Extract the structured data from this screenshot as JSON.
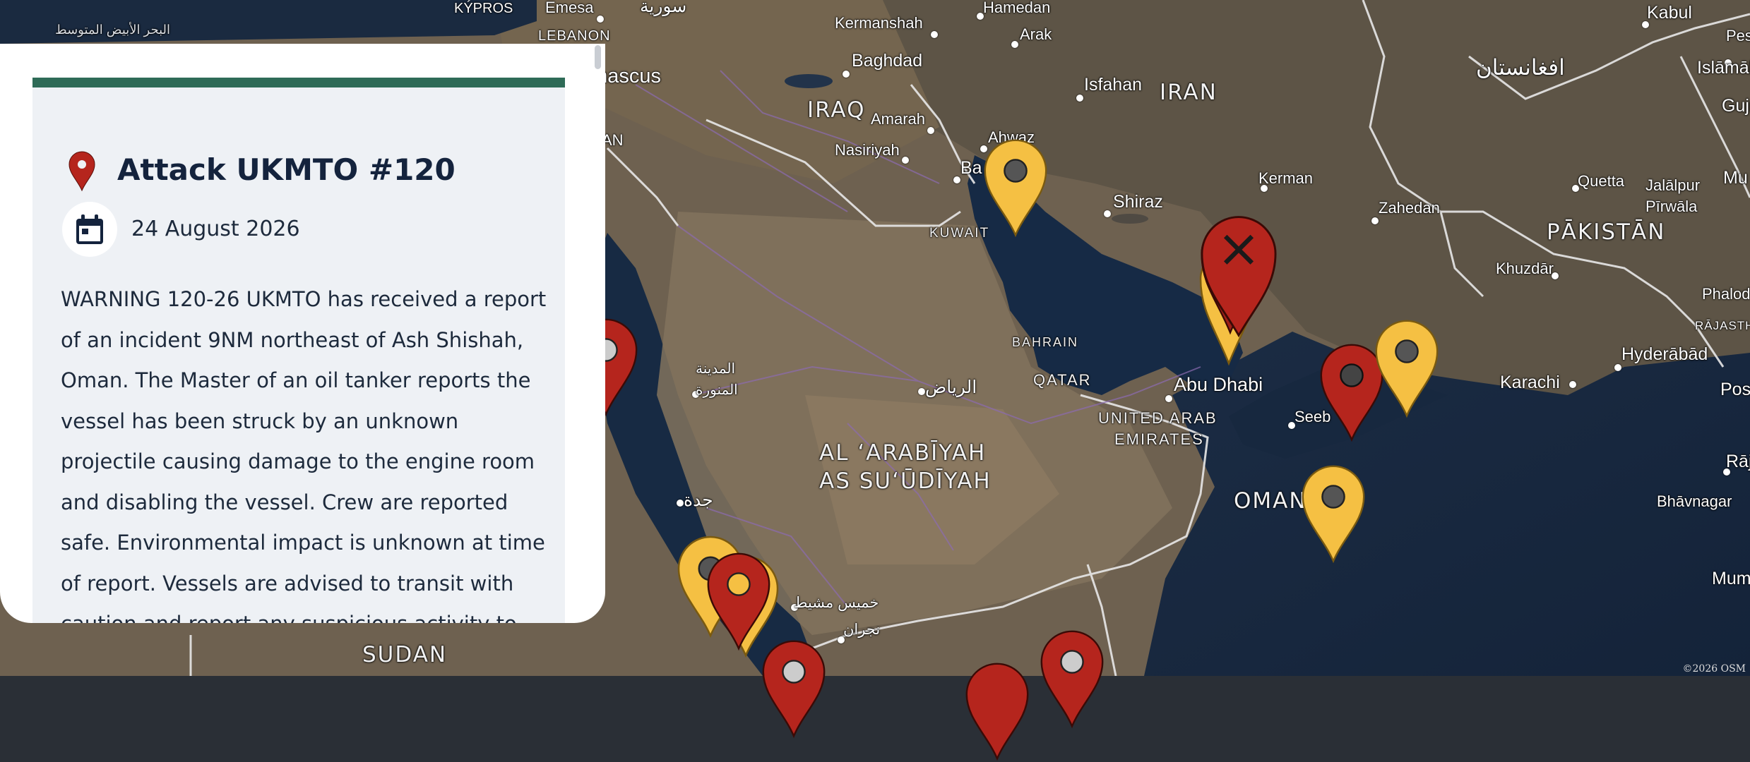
{
  "popup": {
    "title": "Attack UKMTO #120",
    "date": "24 August 2026",
    "body": "WARNING 120-26 UKMTO has received a report of an incident 9NM northeast of Ash Shishah, Oman. The Master of an oil tanker reports the vessel has been struck by an unknown projectile causing damage to the engine room and disabling the vessel. Crew are reported safe. Environmental impact is unknown at time of report. Vessels are advised to transit with caution and report any suspicious activity to UKMTO. Authorities are investigating.",
    "accent_color": "#2e6b57",
    "pin_color": "#b5251d"
  },
  "map": {
    "labels": {
      "iran": "IRAN",
      "iraq": "IRAQ",
      "kuwait": "KUWAIT",
      "bahrain": "BAHRAIN",
      "qatar": "QATAR",
      "uae_1": "UNITED ARAB",
      "uae_2": "EMIRATES",
      "saudi_1": "AL ʻARABĪYAH",
      "saudi_2": "AS SUʻŪDĪYAH",
      "oman": "OMAN",
      "pakistan": "PĀKISTĀN",
      "sudan": "SUDAN",
      "afghanistan": "افغانستان",
      "syria": "سورية",
      "lebanon": "LEBANON",
      "kypros": "KÝPROS",
      "mediterranean": "البحر الأبيض المتوسط",
      "kermanshah": "Kermanshah",
      "hamedan": "Hamedan",
      "arak": "Arak",
      "baghdad": "Baghdad",
      "damascus": "amascus",
      "emesa": "Emesa",
      "amarah": "Amarah",
      "nasiriyah": "Nasiriyah",
      "ahwaz": "Ahwaz",
      "basra": "Ba",
      "isfahan": "Isfahan",
      "shiraz": "Shiraz",
      "kerman": "Kerman",
      "zahedan": "Zahedan",
      "abudhabi": "Abu Dhabi",
      "seeb": "Seeb",
      "riyadh": "الرياض",
      "madinah_1": "المدينة",
      "madinah_2": "المنورة",
      "jeddah": "جدة",
      "khamis": "خميس مشيط",
      "najran": "نجران",
      "kabul": "Kabul",
      "pes": "Pes",
      "islamabad": "Islāmāba",
      "gujra": "Gujrā",
      "quetta": "Quetta",
      "jalalpur": "Jalālpur",
      "pirwala": "Pīrwāla",
      "mu": "Mu",
      "khuzdar": "Khuzdār",
      "phalodi": "Phalodi",
      "rajasthan": "RĀJASTHĀ",
      "hyderabad": "Hyderābād",
      "karachi": "Karachi",
      "poshin": "Poshin",
      "rajkot": "Rājkot",
      "bhavnagar": "Bhāvnagar",
      "mumbai": "Mumba",
      "an": "AN",
      "kb": "ar"
    },
    "attribution": "©2026 OSM",
    "marker_colors": {
      "yellow": "#f5c043",
      "red": "#b5251d"
    }
  }
}
